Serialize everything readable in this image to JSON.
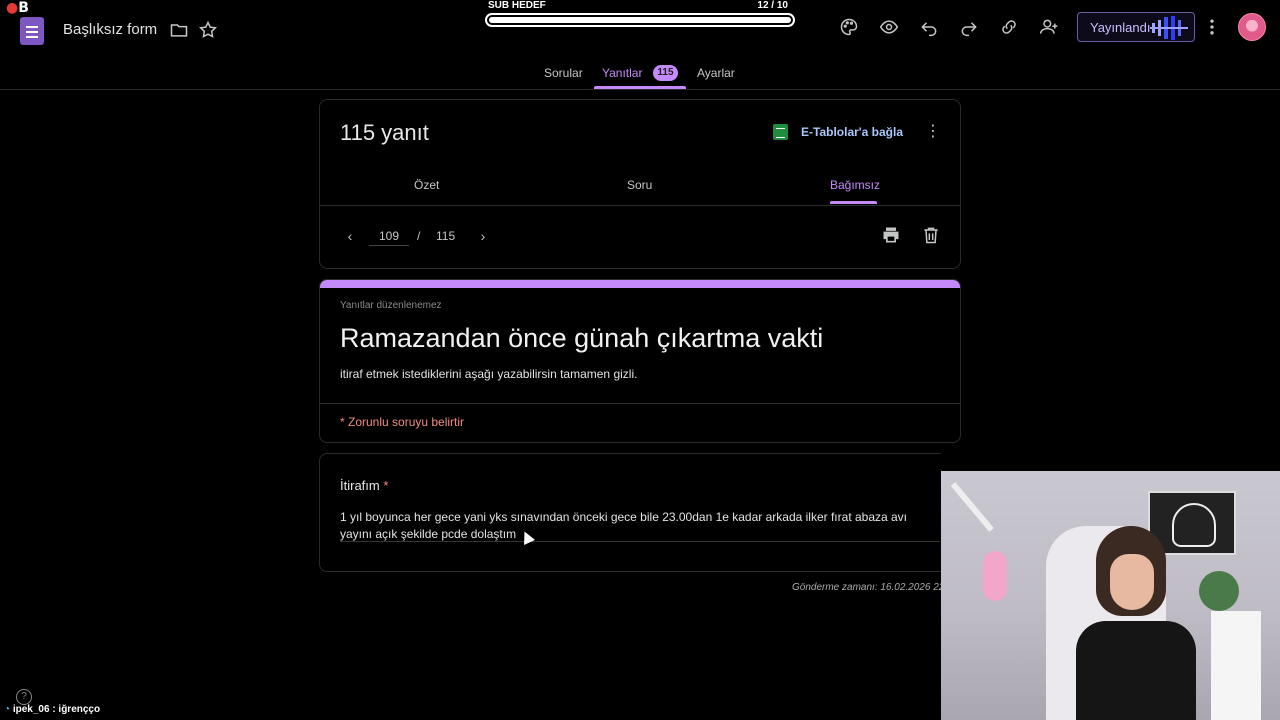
{
  "header": {
    "form_title": "Başlıksız form",
    "publish_label": "Yayınlandı",
    "overlay_logo": "B"
  },
  "sub_goal": {
    "label": "SUB HEDEF",
    "count": "12  / 10",
    "progress": 1.0
  },
  "tabs": {
    "questions": "Sorular",
    "responses": "Yanıtlar",
    "responses_count": "115",
    "settings": "Ayarlar"
  },
  "summary": {
    "title": "115 yanıt",
    "sheets_link": "E-Tablolar'a bağla",
    "subtabs": [
      "Özet",
      "Soru",
      "Bağımsız"
    ],
    "pager_current": "109",
    "pager_sep": "/",
    "pager_total": "115"
  },
  "form": {
    "not_editable": "Yanıtlar düzenlenemez",
    "heading": "Ramazandan önce günah çıkartma vakti",
    "description": "itiraf etmek istediklerini aşağı yazabilirsin tamamen gizli.",
    "required_note": "* Zorunlu soruyu belirtir"
  },
  "question": {
    "label": "İtirafım",
    "required_mark": "*",
    "answer": "1 yıl boyunca her gece yani yks sınavından önceki gece bile 23.00dan 1e kadar arkada ilker fırat abaza avı yayını açık şekilde pcde dolaştım"
  },
  "submit_time": "Gönderme zamanı: 16.02.2026 22:",
  "chat": {
    "user": "ipek_06",
    "message": ": iğrençço"
  },
  "colors": {
    "accent": "#c58af9",
    "link": "#a8c7fa",
    "required": "#f28b82",
    "sheets_green": "#1e8e3e"
  },
  "icons": [
    "forms-app-icon",
    "folder-icon",
    "star-icon",
    "palette-icon",
    "eye-icon",
    "undo-icon",
    "redo-icon",
    "link-icon",
    "add-person-icon",
    "more-vert-icon",
    "chevron-left-icon",
    "chevron-right-icon",
    "print-icon",
    "trash-icon",
    "help-icon"
  ]
}
